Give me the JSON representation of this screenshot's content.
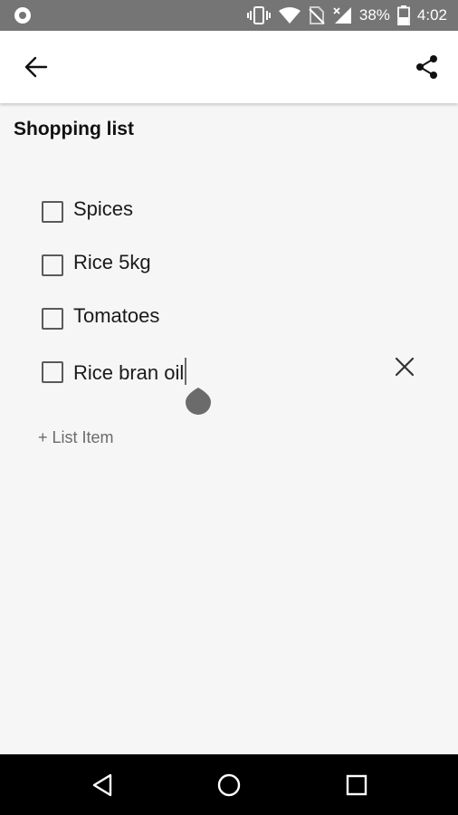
{
  "status_bar": {
    "battery_percent": "38%",
    "time": "4:02",
    "icons": [
      "circle-indicator-icon",
      "vibrate-icon",
      "wifi-icon",
      "no-sim-icon",
      "signal-icon",
      "battery-icon"
    ]
  },
  "app_bar": {
    "icons": [
      "back-arrow-icon",
      "share-icon"
    ]
  },
  "note": {
    "title": "Shopping list",
    "items": [
      {
        "label": "Spices",
        "checked": false
      },
      {
        "label": "Rice 5kg",
        "checked": false
      },
      {
        "label": "Tomatoes",
        "checked": false
      },
      {
        "label": "Rice bran oil",
        "checked": false,
        "editing": true
      }
    ],
    "add_item_label": "+ List Item"
  },
  "nav_bar": {
    "icons": [
      "back-triangle-icon",
      "home-circle-icon",
      "recents-square-icon"
    ]
  },
  "colors": {
    "status_bar": "#757575",
    "app_bar": "#ffffff",
    "background": "#f6f6f6",
    "nav_bar": "#000000"
  }
}
